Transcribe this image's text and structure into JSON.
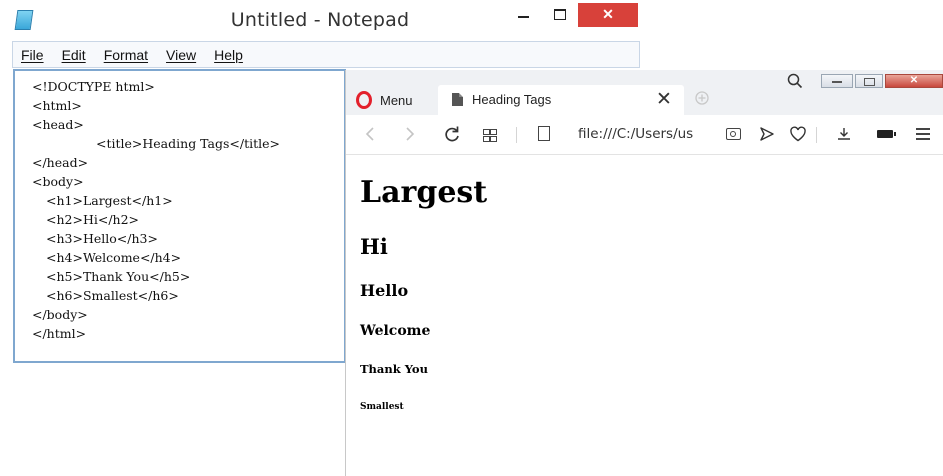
{
  "notepad": {
    "title": "Untitled - Notepad",
    "close_glyph": "✕",
    "menu": [
      "File",
      "Edit",
      "Format",
      "View",
      "Help"
    ],
    "lines": [
      "<!DOCTYPE html>",
      "<html>",
      "<head>",
      "<title>Heading Tags</title>",
      "</head>",
      "<body>",
      "<h1>Largest</h1>",
      "<h2>Hi</h2>",
      "<h3>Hello</h3>",
      "<h4>Welcome</h4>",
      "<h5>Thank You</h5>",
      "<h6>Smallest</h6>",
      "</body>",
      "</html>"
    ]
  },
  "browser": {
    "menu_label": "Menu",
    "tab_title": "Heading Tags",
    "tab_close_glyph": "✕",
    "window_close_glyph": "✕",
    "address": "file:///C:/Users/us",
    "headings": {
      "h1": "Largest",
      "h2": "Hi",
      "h3": "Hello",
      "h4": "Welcome",
      "h5": "Thank You",
      "h6": "Smallest"
    }
  },
  "colors": {
    "close_red": "#d8413a",
    "opera_red": "#e3202b",
    "menubar_border": "#c9d6e6",
    "editor_border": "#7fa7cf"
  },
  "icons": {
    "notepad_app": "notepad-icon",
    "minimize": "minimize-icon",
    "maximize": "maximize-icon",
    "close": "close-icon",
    "opera": "opera-logo-icon",
    "doc": "document-icon",
    "new_tab": "plus-icon",
    "search": "search-icon",
    "back": "arrow-left-icon",
    "forward": "arrow-right-icon",
    "reload": "reload-icon",
    "speed_dial": "grid-icon",
    "page": "page-icon",
    "snapshot": "camera-icon",
    "send": "send-icon",
    "favorite": "heart-icon",
    "download": "download-icon",
    "battery": "battery-icon",
    "settings": "sliders-icon"
  }
}
